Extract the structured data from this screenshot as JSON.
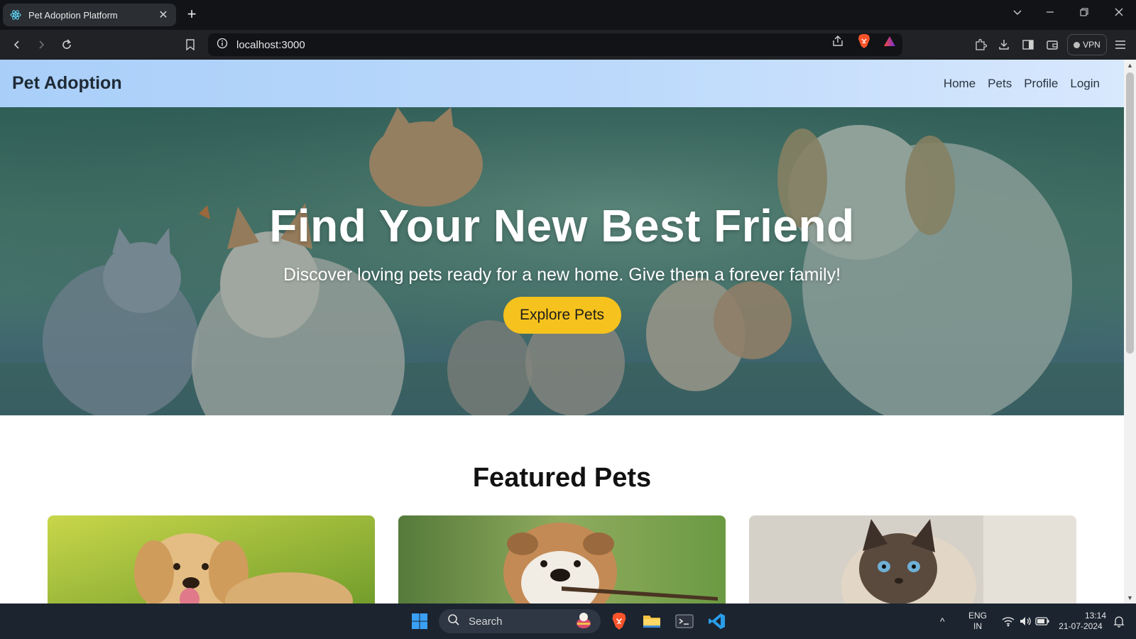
{
  "browser": {
    "tab_title": "Pet Adoption Platform",
    "url": "localhost:3000",
    "vpn_label": "VPN"
  },
  "navbar": {
    "brand": "Pet Adoption",
    "links": [
      "Home",
      "Pets",
      "Profile",
      "Login"
    ]
  },
  "hero": {
    "title": "Find Your New Best Friend",
    "subtitle": "Discover loving pets ready for a new home. Give them a forever family!",
    "cta_label": "Explore Pets"
  },
  "featured": {
    "title": "Featured Pets"
  },
  "taskbar": {
    "search_label": "Search",
    "lang_line1": "ENG",
    "lang_line2": "IN",
    "time": "13:14",
    "date": "21-07-2024"
  },
  "colors": {
    "cta": "#f6c21d",
    "navbar_start": "#a9cff9",
    "navbar_end": "#d8e8fd",
    "taskbar": "#1c2430"
  }
}
